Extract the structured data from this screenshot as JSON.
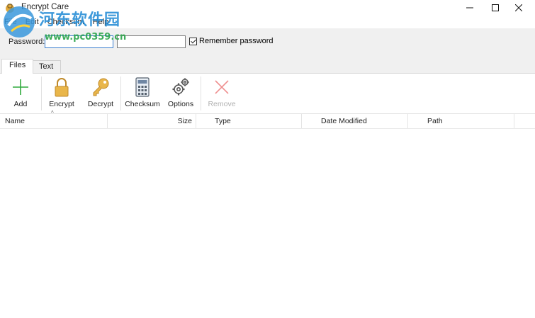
{
  "window": {
    "title": "Encrypt Care"
  },
  "menu": [
    "File",
    "Edit",
    "Checksum",
    "Help"
  ],
  "watermark": {
    "text": "河东软件园",
    "url": "www.pc0359.cn"
  },
  "password": {
    "label": "Password:",
    "value1": "",
    "value2": "",
    "remember_label": "Remember password",
    "remember_checked": true
  },
  "tabs": [
    {
      "label": "Files",
      "active": true
    },
    {
      "label": "Text",
      "active": false
    }
  ],
  "toolbar": {
    "add": "Add",
    "encrypt": "Encrypt",
    "decrypt": "Decrypt",
    "checksum": "Checksum",
    "options": "Options",
    "remove": "Remove"
  },
  "columns": [
    "Name",
    "Size",
    "Type",
    "Date Modified",
    "Path"
  ],
  "colors": {
    "accent": "#3c7fd0",
    "add_green": "#2faa3c",
    "lock_gold": "#e0a53a",
    "remove_red": "#e86a6a"
  }
}
